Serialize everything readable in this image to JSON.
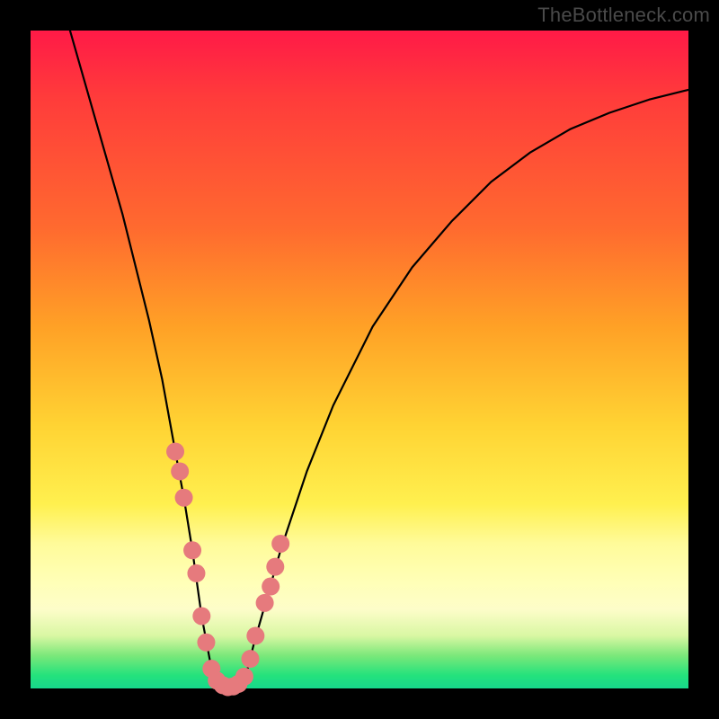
{
  "watermark": "TheBottleneck.com",
  "chart_data": {
    "type": "line",
    "title": "",
    "xlabel": "",
    "ylabel": "",
    "xlim": [
      0,
      100
    ],
    "ylim": [
      0,
      100
    ],
    "grid": false,
    "legend": false,
    "series": [
      {
        "name": "curve",
        "color": "#000000",
        "x": [
          6,
          10,
          14,
          18,
          20,
          22,
          23.3,
          24.6,
          26,
          27.5,
          29,
          30,
          31.5,
          33,
          34,
          36,
          38,
          42,
          46,
          52,
          58,
          64,
          70,
          76,
          82,
          88,
          94,
          100
        ],
        "y": [
          100,
          86,
          72,
          56,
          47,
          36,
          29,
          21,
          11,
          3,
          0.5,
          0,
          0.5,
          3,
          7,
          14,
          21,
          33,
          43,
          55,
          64,
          71,
          77,
          81.5,
          85,
          87.5,
          89.5,
          91
        ]
      },
      {
        "name": "markers-left",
        "type": "scatter",
        "color": "#e67a7d",
        "x": [
          22.0,
          22.7,
          23.3,
          24.6,
          25.2,
          26.0,
          26.7,
          27.5
        ],
        "y": [
          36,
          33,
          29,
          21,
          17.5,
          11,
          7,
          3
        ]
      },
      {
        "name": "markers-bottom",
        "type": "scatter",
        "color": "#e67a7d",
        "x": [
          28.3,
          29.2,
          30.0,
          30.8,
          31.6,
          32.5
        ],
        "y": [
          1.2,
          0.5,
          0.2,
          0.3,
          0.7,
          1.8
        ]
      },
      {
        "name": "markers-right",
        "type": "scatter",
        "color": "#e67a7d",
        "x": [
          33.4,
          34.2,
          35.6,
          36.5,
          37.2,
          38.0
        ],
        "y": [
          4.5,
          8,
          13,
          15.5,
          18.5,
          22
        ]
      }
    ]
  }
}
